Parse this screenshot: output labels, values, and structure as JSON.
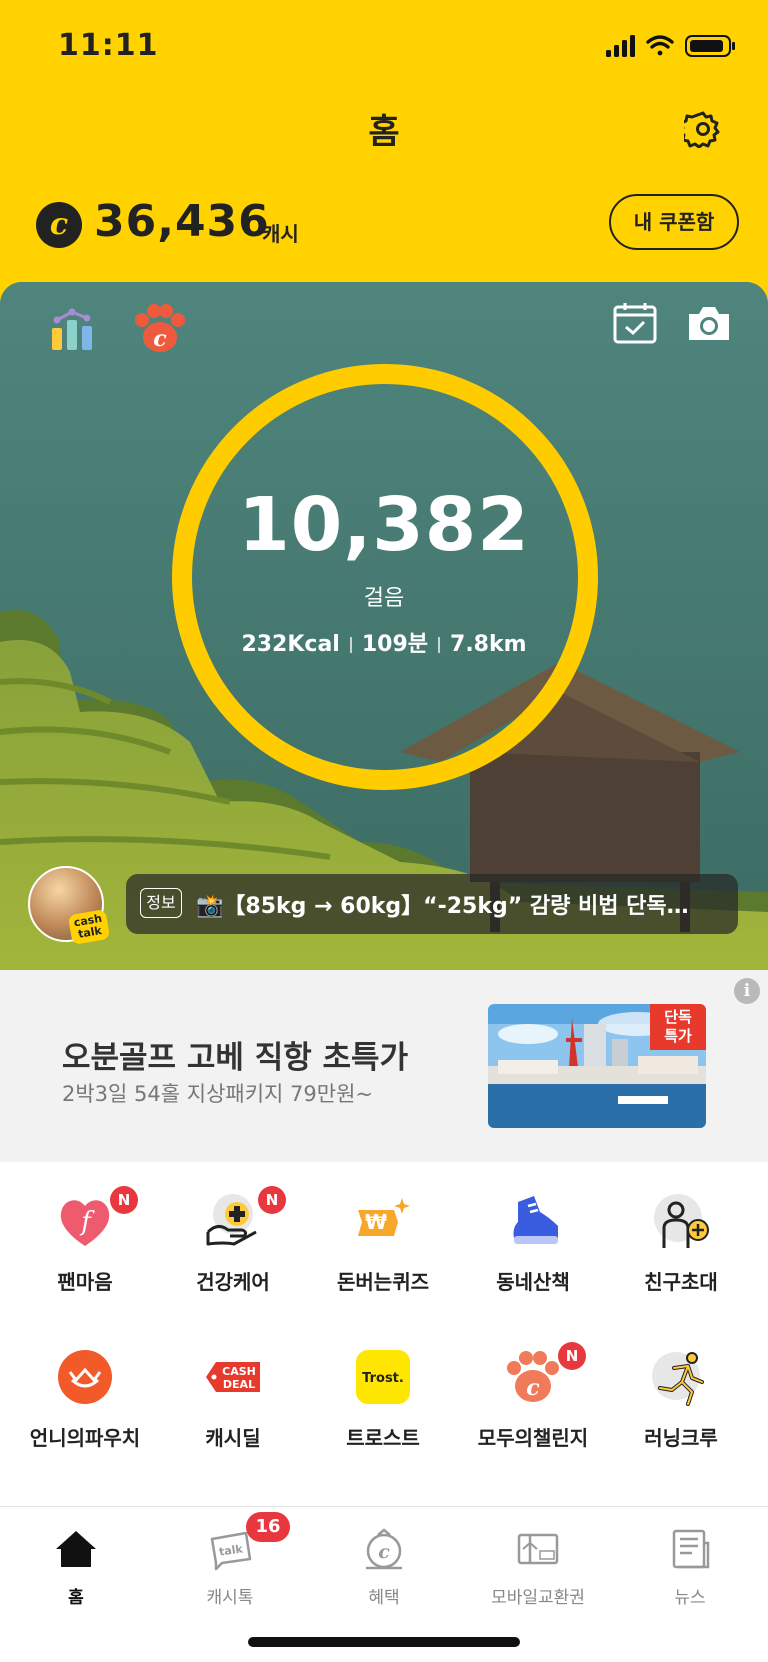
{
  "status": {
    "time": "11:11"
  },
  "header": {
    "title": "홈",
    "settings_icon": "gear-icon"
  },
  "cash": {
    "icon": "cash-coin-icon",
    "icon_letter": "c",
    "amount": "36,436",
    "unit": "캐시",
    "coupon_button": "내 쿠폰함"
  },
  "hero": {
    "icons": [
      "stats-chart-icon",
      "paw-challenge-icon",
      "calendar-check-icon",
      "camera-icon"
    ],
    "paw_letter": "c",
    "steps": "10,382",
    "steps_label": "걸음",
    "kcal": "232Kcal",
    "minutes": "109분",
    "distance": "7.8km",
    "avatar_badge": "cash talk",
    "news_tag": "정보",
    "news_text": "📸【85kg → 60kg】“-25kg” 감량 비법 단독…"
  },
  "ad": {
    "title": "오분골프 고베 직항 초특가",
    "subtitle": "2박3일 54홀 지상패키지 79만원~",
    "badge": "단독\n특가",
    "info": "i"
  },
  "menu": [
    {
      "label": "팬마음",
      "icon": "heart-f-icon",
      "badge": "N"
    },
    {
      "label": "건강케어",
      "icon": "health-care-icon",
      "badge": "N"
    },
    {
      "label": "돈버는퀴즈",
      "icon": "quiz-icon",
      "badge": ""
    },
    {
      "label": "동네산책",
      "icon": "sneaker-icon",
      "badge": ""
    },
    {
      "label": "친구초대",
      "icon": "invite-friend-icon",
      "badge": ""
    },
    {
      "label": "언니의파우치",
      "icon": "pouch-icon",
      "badge": ""
    },
    {
      "label": "캐시딜",
      "icon": "cash-deal-icon",
      "badge": ""
    },
    {
      "label": "트로스트",
      "icon": "trost-icon",
      "badge": ""
    },
    {
      "label": "모두의챌린지",
      "icon": "paw-challenge-icon",
      "badge": "N"
    },
    {
      "label": "러닝크루",
      "icon": "runner-icon",
      "badge": ""
    }
  ],
  "menu_texts": {
    "cash_deal": "CASH\nDEAL",
    "trost": "Trost.",
    "paw_letter": "c"
  },
  "nav": {
    "items": [
      {
        "label": "홈",
        "icon": "home-icon",
        "active": true
      },
      {
        "label": "캐시톡",
        "icon": "talk-icon",
        "active": false
      },
      {
        "label": "혜택",
        "icon": "benefit-icon",
        "active": false
      },
      {
        "label": "모바일교환권",
        "icon": "voucher-icon",
        "active": false
      },
      {
        "label": "뉴스",
        "icon": "news-icon",
        "active": false
      }
    ],
    "talk_badge": "16",
    "talk_text": "talk"
  },
  "colors": {
    "brand_yellow": "#FFD200",
    "ring_yellow": "#FFCC00",
    "badge_red": "#e8373e"
  }
}
